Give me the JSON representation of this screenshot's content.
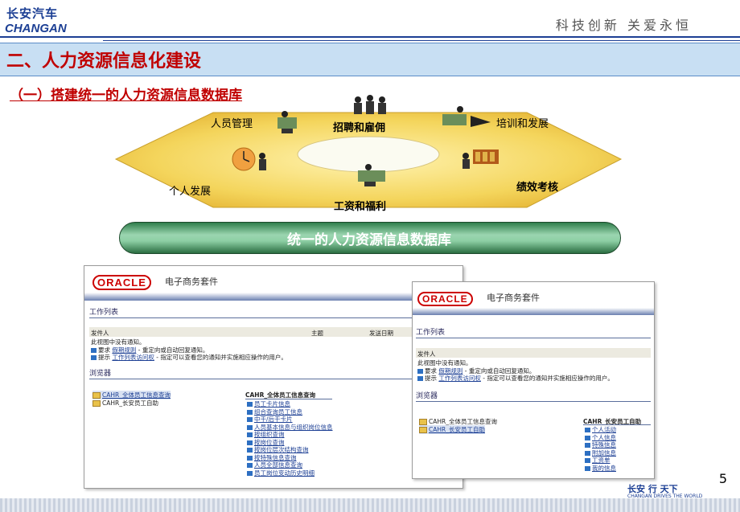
{
  "header": {
    "logo_cn": "长安汽车",
    "logo_en": "CHANGAN",
    "slogan": "科技创新 关爱永恒"
  },
  "section_title": "二、人力资源信息化建设",
  "subtitle": "（一）搭建统一的人力资源信息数据库",
  "diagram": {
    "labels": {
      "personnel": "人员管理",
      "recruit": "招聘和雇佣",
      "training": "培训和发展",
      "personal_dev": "个人发展",
      "performance": "绩效考核",
      "salary": "工资和福利"
    },
    "database": "统一的人力资源信息数据库"
  },
  "oracle_left": {
    "logo": "ORACLE",
    "suite": "电子商务套件",
    "worklist": "工作列表",
    "col_from": "发件人",
    "col_subject": "主题",
    "col_date": "发送日期",
    "no_notice": "此视图中没有通知。",
    "hint1_prefix": "要求",
    "hint1_link": "假期规则",
    "hint1_text": "- 重定向或自动回复通知。",
    "hint2_prefix": "提示",
    "hint2_link": "工作列表访问权",
    "hint2_text": "- 指定可以查看您的通知并实施相应操作的用户。",
    "browser": "浏览器",
    "folders": [
      "CAHR_全体员工信息查询",
      "CAHR_长安员工自助"
    ],
    "panel_title": "CAHR_全体员工信息查询",
    "items": [
      "员工卡片信息",
      "组合查询员工信息",
      "中干/后干卡片",
      "人员基本信息与组织岗位信息",
      "按组织查询",
      "按岗位查询",
      "按岗位层次结构查询",
      "按特殊信息查询",
      "人员全部信息查询",
      "员工岗位变动历史明细"
    ]
  },
  "oracle_right": {
    "logo": "ORACLE",
    "suite": "电子商务套件",
    "worklist": "工作列表",
    "col_from": "发件人",
    "no_notice": "此视图中没有通知。",
    "hint1_prefix": "要求",
    "hint1_link": "假期规则",
    "hint1_text": "- 重定向或自动回复通知。",
    "hint2_prefix": "提示",
    "hint2_link": "工作列表访问权",
    "hint2_text": "- 指定可以查看您的通知并实施相应操作的用户。",
    "browser": "浏览器",
    "folders": [
      "CAHR_全体员工信息查询",
      "CAHR_长安员工自助"
    ],
    "panel_title": "CAHR_长安员工自助",
    "items": [
      "个人活动",
      "个人信息",
      "特殊信息",
      "附加信息",
      "工资单",
      "我的信息"
    ]
  },
  "page_number": "5",
  "footer": {
    "logo": "长安 行 天下",
    "sub": "CHANGAN DRIVES  THE WORLD"
  },
  "colors": {
    "brand_blue": "#1c3f94",
    "title_red": "#c00000",
    "title_bar": "#c8dff3",
    "diamond_yellow": "#f5d760",
    "db_green": "#8dcfa4",
    "oracle_red": "#cc0000"
  }
}
